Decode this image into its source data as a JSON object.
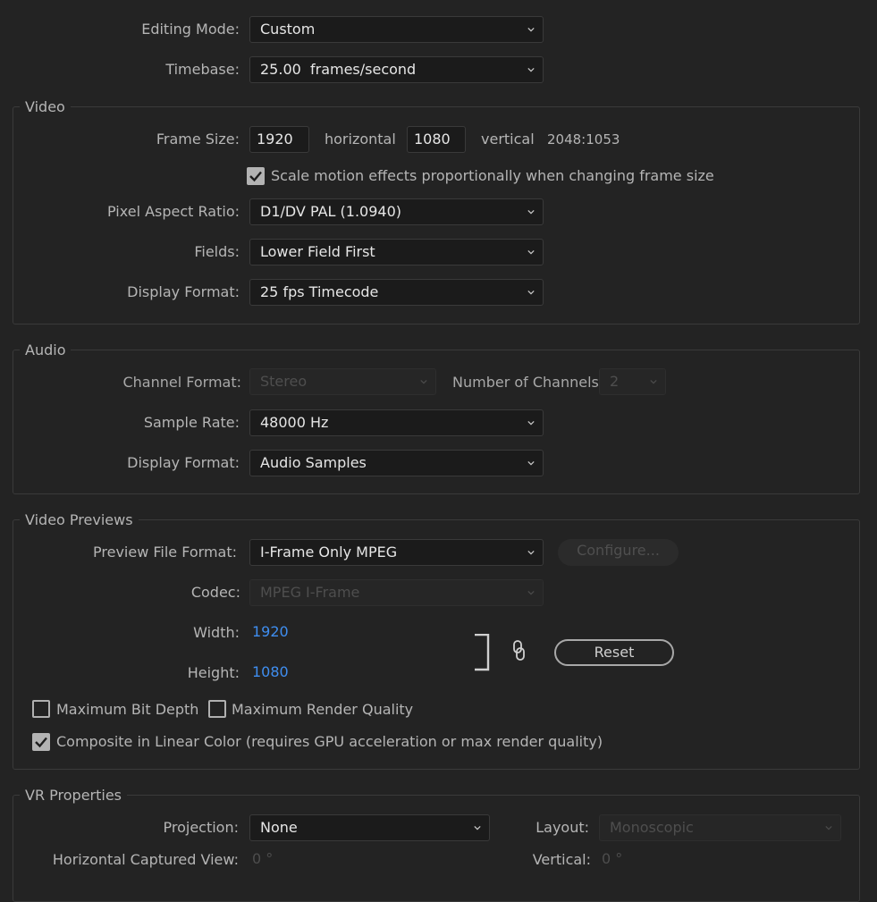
{
  "general": {
    "editing_mode": {
      "label": "Editing Mode:",
      "value": "Custom"
    },
    "timebase": {
      "label": "Timebase:",
      "value": "25.00  frames/second"
    }
  },
  "video": {
    "title": "Video",
    "frame_size": {
      "label": "Frame Size:",
      "width": "1920",
      "horizontal": "horizontal",
      "height": "1080",
      "vertical": "vertical",
      "ratio": "2048:1053"
    },
    "scale_motion": {
      "label": "Scale motion effects proportionally when changing frame size",
      "checked": true
    },
    "pixel_aspect": {
      "label": "Pixel Aspect Ratio:",
      "value": "D1/DV PAL (1.0940)"
    },
    "fields": {
      "label": "Fields:",
      "value": "Lower Field First"
    },
    "display_format": {
      "label": "Display Format:",
      "value": "25 fps Timecode"
    }
  },
  "audio": {
    "title": "Audio",
    "channel_format": {
      "label": "Channel Format:",
      "value": "Stereo"
    },
    "num_channels": {
      "label": "Number of Channels:",
      "value": "2"
    },
    "sample_rate": {
      "label": "Sample Rate:",
      "value": "48000 Hz"
    },
    "display_format": {
      "label": "Display Format:",
      "value": "Audio Samples"
    }
  },
  "previews": {
    "title": "Video Previews",
    "file_format": {
      "label": "Preview File Format:",
      "value": "I-Frame Only MPEG"
    },
    "configure": "Configure...",
    "codec": {
      "label": "Codec:",
      "value": "MPEG I-Frame"
    },
    "width": {
      "label": "Width:",
      "value": "1920"
    },
    "height": {
      "label": "Height:",
      "value": "1080"
    },
    "reset": "Reset",
    "max_bit_depth": {
      "label": "Maximum Bit Depth",
      "checked": false
    },
    "max_render": {
      "label": "Maximum Render Quality",
      "checked": false
    },
    "linear_color": {
      "label": "Composite in Linear Color (requires GPU acceleration or max render quality)",
      "checked": true
    }
  },
  "vr": {
    "title": "VR Properties",
    "projection": {
      "label": "Projection:",
      "value": "None"
    },
    "layout": {
      "label": "Layout:",
      "value": "Monoscopic"
    },
    "h_view": {
      "label": "Horizontal Captured View:",
      "value": "0 °"
    },
    "vertical": {
      "label": "Vertical:",
      "value": "0 °"
    }
  }
}
